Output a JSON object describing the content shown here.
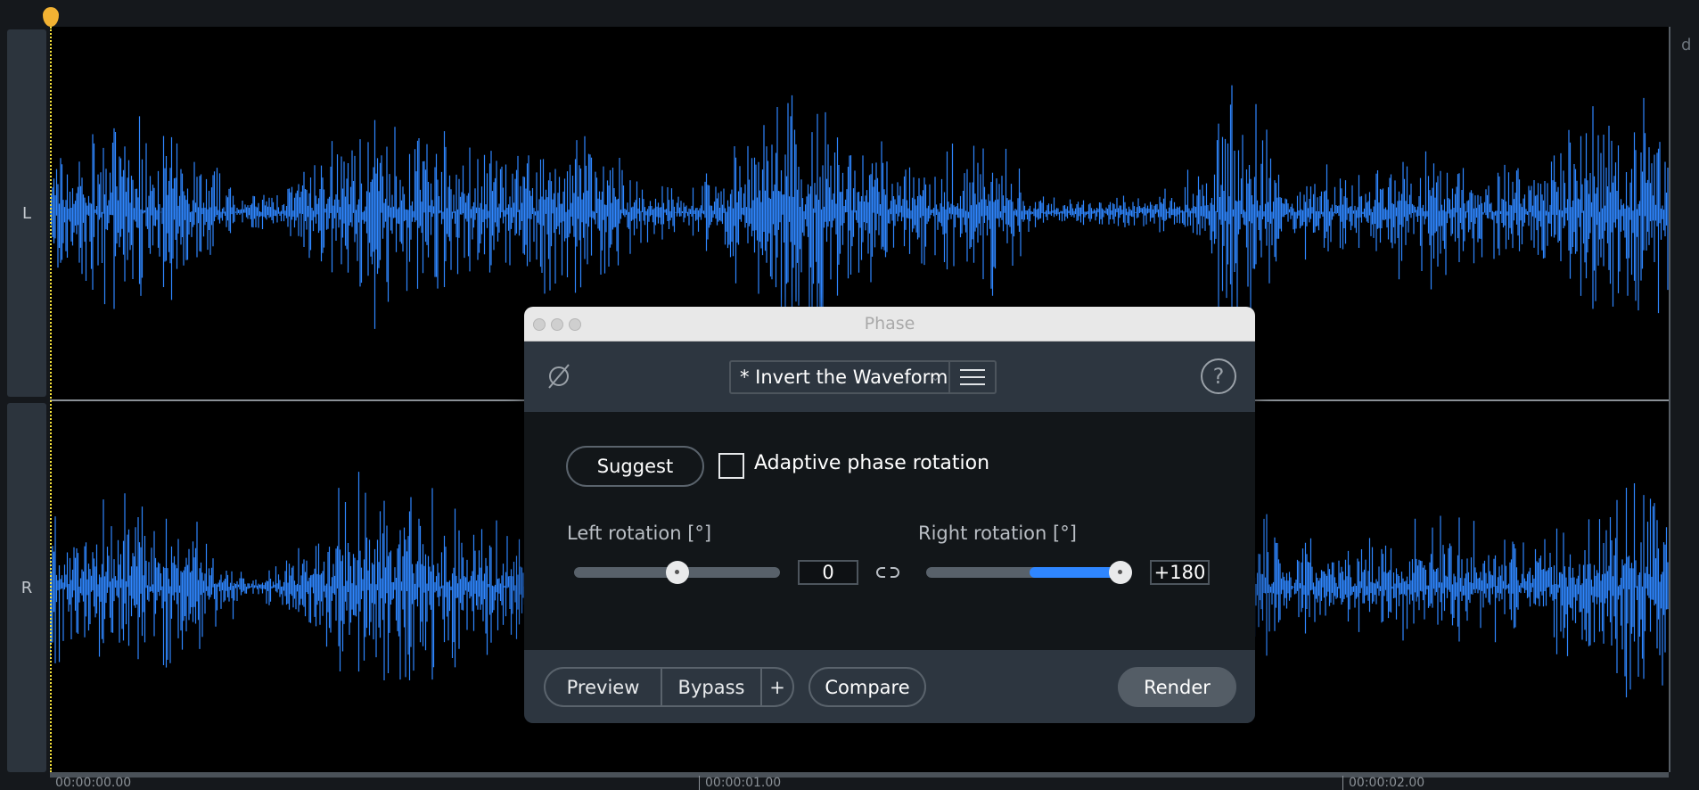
{
  "channels": {
    "left": "L",
    "right": "R"
  },
  "ruler": {
    "unit_label": "d"
  },
  "timeline": {
    "labels": [
      "00:00:00.00",
      "00:00:01.00",
      "00:00:02.00"
    ]
  },
  "dialog": {
    "title": "Phase",
    "preset": "* Invert the Waveform",
    "suggest_label": "Suggest",
    "adaptive_label": "Adaptive phase rotation",
    "adaptive_checked": false,
    "left_rotation": {
      "label": "Left rotation [°]",
      "value": "0",
      "fraction": 0.5
    },
    "right_rotation": {
      "label": "Right rotation [°]",
      "value": "+180",
      "fraction": 1.0
    },
    "footer": {
      "preview": "Preview",
      "bypass": "Bypass",
      "plus": "+",
      "compare": "Compare",
      "render": "Render"
    }
  },
  "colors": {
    "waveform": "#2f86ff",
    "accent": "#2f86ff",
    "playhead": "#f2b233"
  }
}
